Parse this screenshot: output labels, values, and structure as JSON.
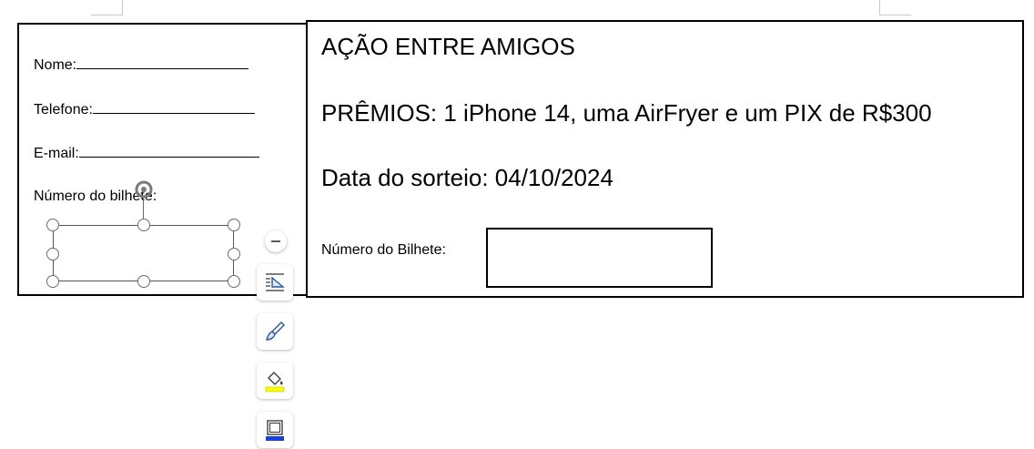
{
  "stub": {
    "name_label": "Nome:",
    "phone_label": "Telefone:",
    "email_label": "E-mail:",
    "ticket_number_label": "Número do bilhete:"
  },
  "main": {
    "title": "AÇÃO ENTRE AMIGOS",
    "prizes": "PRÊMIOS: 1 iPhone 14, uma AirFryer e um PIX de R$300",
    "draw_date": "Data do sorteio: 04/10/2024",
    "ticket_number_label": "Número do Bilhete:"
  },
  "toolbar": {
    "items": [
      {
        "icon": "collapse-icon"
      },
      {
        "icon": "layout-options-icon"
      },
      {
        "icon": "style-brush-icon"
      },
      {
        "icon": "shape-fill-icon"
      },
      {
        "icon": "shape-outline-icon"
      }
    ]
  },
  "colors": {
    "fill_accent": "#ffff00",
    "outline_accent": "#1a3fd6",
    "icon_blue": "#2b579a"
  }
}
